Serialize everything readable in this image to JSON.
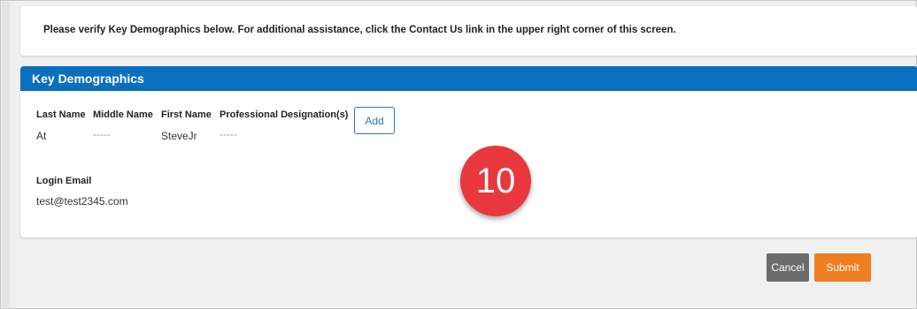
{
  "notice": {
    "text": "Please verify Key Demographics below. For additional assistance, click the Contact Us link in the upper right corner of this screen."
  },
  "panel": {
    "title": "Key Demographics",
    "fields": {
      "last_name": {
        "label": "Last Name",
        "value": "At"
      },
      "middle_name": {
        "label": "Middle Name",
        "value": "-----"
      },
      "first_name": {
        "label": "First Name",
        "value": "SteveJr"
      },
      "designation": {
        "label": "Professional Designation(s)",
        "value": "-----"
      },
      "login_email": {
        "label": "Login Email",
        "value": "test@test2345.com"
      }
    },
    "add_label": "Add"
  },
  "step_badge": "10",
  "actions": {
    "cancel_label": "Cancel",
    "submit_label": "Submit"
  },
  "colors": {
    "header_blue": "#0a6fbf",
    "submit_orange": "#ef7d22",
    "cancel_gray": "#6b6b6b",
    "badge_red": "#e8383d"
  }
}
